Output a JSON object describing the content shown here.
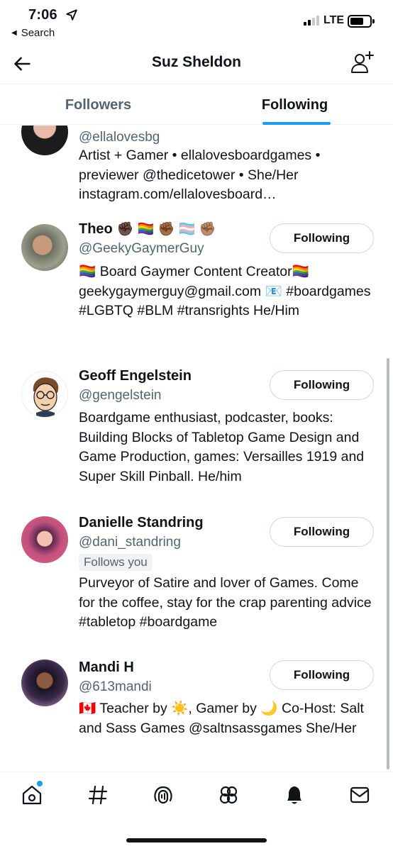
{
  "status_bar": {
    "time": "7:06",
    "back_label": "Search",
    "network": "LTE"
  },
  "header": {
    "title": "Suz Sheldon"
  },
  "tabs": [
    {
      "label": "Followers",
      "active": false
    },
    {
      "label": "Following",
      "active": true
    }
  ],
  "users": [
    {
      "name": "",
      "handle": "@ellalovesbg",
      "bio": "Artist + Gamer • ellalovesboardgames • previewer @thedicetower • She/Her instagram.com/ellalovesboard…"
    },
    {
      "name": "Theo",
      "name_emoji": "✊🏿 🏳️‍🌈 ✊🏾 🏳️‍⚧️ ✊🏽",
      "handle": "@GeekyGaymerGuy",
      "bio": "🏳️‍🌈 Board Gaymer Content Creator🏳️‍🌈 geekygaymerguy@gmail.com 📧 #boardgames #LGBTQ #BLM #transrights He/Him",
      "button": "Following"
    },
    {
      "name": "Geoff Engelstein",
      "handle": "@gengelstein",
      "bio": "Boardgame enthusiast, podcaster, books: Building Blocks of Tabletop Game Design and Game Production, games: Versailles 1919 and Super Skill Pinball. He/him",
      "button": "Following"
    },
    {
      "name": "Danielle Standring",
      "handle": "@dani_standring",
      "badge": "Follows you",
      "bio": "Purveyor of Satire and lover of Games. Come for the coffee, stay for the crap parenting advice #tabletop #boardgame",
      "button": "Following"
    },
    {
      "name": "Mandi H",
      "handle": "@613mandi",
      "bio": "🇨🇦 Teacher by ☀️, Gamer by 🌙 Co-Host: Salt and Sass Games @saltnsassgames She/Her",
      "button": "Following"
    }
  ],
  "nav": [
    {
      "icon": "home-icon",
      "has_notification": true
    },
    {
      "icon": "explore-hash-icon"
    },
    {
      "icon": "spaces-icon"
    },
    {
      "icon": "communities-icon"
    },
    {
      "icon": "notifications-bell-icon"
    },
    {
      "icon": "messages-mail-icon"
    }
  ],
  "colors": {
    "accent": "#1d9bf0",
    "text": "#0f1419",
    "muted": "#536471"
  }
}
